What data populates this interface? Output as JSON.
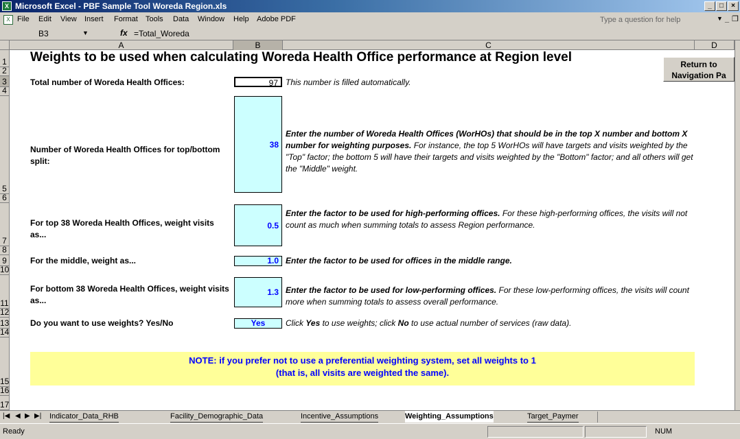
{
  "window": {
    "title": "Microsoft Excel - PBF Sample Tool Woreda Region.xls"
  },
  "menu": {
    "items": [
      "File",
      "Edit",
      "View",
      "Insert",
      "Format",
      "Tools",
      "Data",
      "Window",
      "Help",
      "Adobe PDF"
    ],
    "help_placeholder": "Type a question for help"
  },
  "formula_bar": {
    "cell_ref": "B3",
    "fx": "fx",
    "formula": "=Total_Woreda"
  },
  "columns": [
    "A",
    "B",
    "C",
    "D"
  ],
  "rows": [
    "1",
    "2",
    "3",
    "4",
    "5",
    "6",
    "7",
    "8",
    "9",
    "10",
    "11",
    "12",
    "13",
    "14",
    "15",
    "16",
    "17"
  ],
  "sheet": {
    "heading": "Weights to be used when calculating Woreda Health Office performance at Region level",
    "return_button": "Return to Navigation Pa",
    "total_label": "Total number of Woreda Health Offices:",
    "total_value": "97",
    "total_desc": "This number is filled automatically.",
    "split_label": "Number of Woreda Health Offices for top/bottom split:",
    "split_value": "38",
    "split_desc_bold": "Enter the number of Woreda Health Offices (WorHOs) that should be in the top X number and bottom X number for weighting purposes.",
    "split_desc": "For instance, the top 5 WorHOs will have targets and visits weighted by the \"Top\" factor; the bottom 5 will have their targets and visits weighted by the \"Bottom\" factor; and all others will get the \"Middle\" weight.",
    "top_label": "For top 38 Woreda Health Offices, weight visits as...",
    "top_value": "0.5",
    "top_desc_bold": "Enter the factor to be used for high-performing offices.",
    "top_desc": "For these high-performing offices, the visits will not count as much when summing totals to assess Region performance.",
    "middle_label": "For the middle, weight as...",
    "middle_value": "1.0",
    "middle_desc_bold": "Enter the factor to be used for offices in the middle range.",
    "bottom_label": "For bottom 38 Woreda Health Offices, weight visits as...",
    "bottom_value": "1.3",
    "bottom_desc_bold": "Enter the factor to be used for low-performing offices.",
    "bottom_desc": "For these low-performing offices, the visits will count more when summing totals to assess overall performance.",
    "useweights_label": "Do you want to use weights? Yes/No",
    "useweights_value": "Yes",
    "useweights_desc_1": "Click",
    "useweights_desc_yes": "Yes",
    "useweights_desc_2": "to use weights; click",
    "useweights_desc_no": "No",
    "useweights_desc_3": "to use actual number of services (raw data).",
    "note_line1": "NOTE: if you prefer not to use a preferential weighting system, set all weights to 1",
    "note_line2": "(that is, all visits are weighted the same)."
  },
  "tabs": [
    "Indicator_Data_RHB",
    "Facility_Demographic_Data",
    "Incentive_Assumptions",
    "Weighting_Assumptions",
    "Target_Paymer"
  ],
  "active_tab": "Weighting_Assumptions",
  "status": {
    "ready": "Ready",
    "num": "NUM"
  },
  "colors": {
    "cell_fill": "#ccffff",
    "note_fill": "#ffff99",
    "value_text": "#0000ff"
  }
}
